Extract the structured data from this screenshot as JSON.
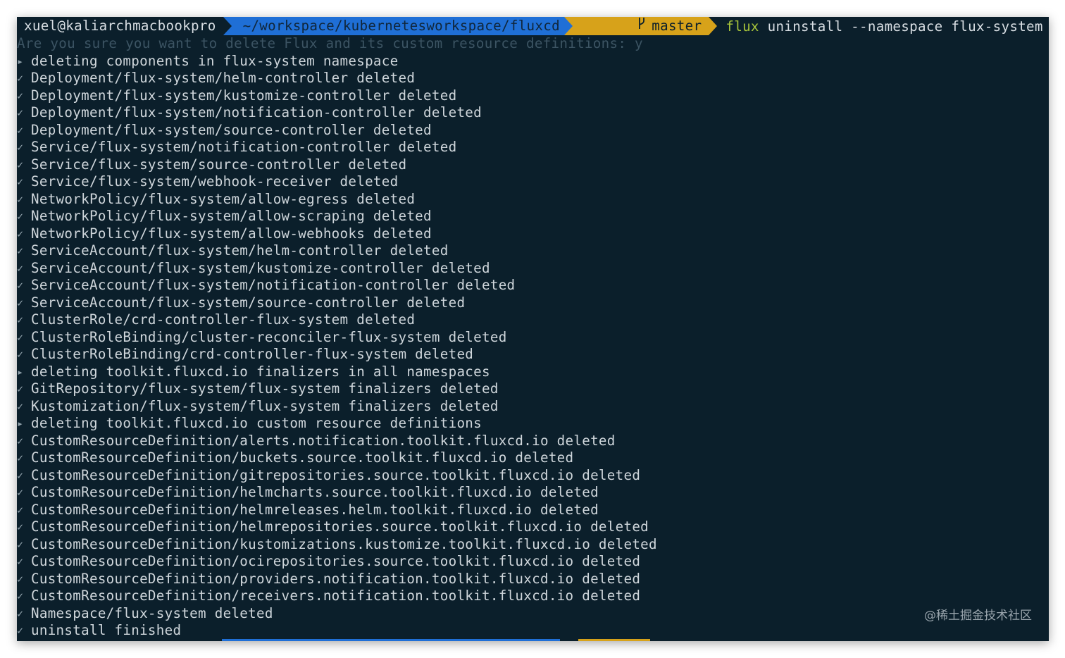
{
  "prompt": {
    "user": "xuel@kaliarchmacbookpro",
    "path": "~/workspace/kubernetesworkspace/fluxcd",
    "branch_icon": "git-branch-icon",
    "branch": "master",
    "command_name": "flux",
    "command_args": " uninstall --namespace flux-system"
  },
  "question": "Are you sure you want to delete Flux and its custom resource definitions: y",
  "output": [
    {
      "mark": "▸",
      "text": "deleting components in flux-system namespace"
    },
    {
      "mark": "✓",
      "text": "Deployment/flux-system/helm-controller deleted"
    },
    {
      "mark": "✓",
      "text": "Deployment/flux-system/kustomize-controller deleted"
    },
    {
      "mark": "✓",
      "text": "Deployment/flux-system/notification-controller deleted"
    },
    {
      "mark": "✓",
      "text": "Deployment/flux-system/source-controller deleted"
    },
    {
      "mark": "✓",
      "text": "Service/flux-system/notification-controller deleted"
    },
    {
      "mark": "✓",
      "text": "Service/flux-system/source-controller deleted"
    },
    {
      "mark": "✓",
      "text": "Service/flux-system/webhook-receiver deleted"
    },
    {
      "mark": "✓",
      "text": "NetworkPolicy/flux-system/allow-egress deleted"
    },
    {
      "mark": "✓",
      "text": "NetworkPolicy/flux-system/allow-scraping deleted"
    },
    {
      "mark": "✓",
      "text": "NetworkPolicy/flux-system/allow-webhooks deleted"
    },
    {
      "mark": "✓",
      "text": "ServiceAccount/flux-system/helm-controller deleted"
    },
    {
      "mark": "✓",
      "text": "ServiceAccount/flux-system/kustomize-controller deleted"
    },
    {
      "mark": "✓",
      "text": "ServiceAccount/flux-system/notification-controller deleted"
    },
    {
      "mark": "✓",
      "text": "ServiceAccount/flux-system/source-controller deleted"
    },
    {
      "mark": "✓",
      "text": "ClusterRole/crd-controller-flux-system deleted"
    },
    {
      "mark": "✓",
      "text": "ClusterRoleBinding/cluster-reconciler-flux-system deleted"
    },
    {
      "mark": "✓",
      "text": "ClusterRoleBinding/crd-controller-flux-system deleted"
    },
    {
      "mark": "▸",
      "text": "deleting toolkit.fluxcd.io finalizers in all namespaces"
    },
    {
      "mark": "✓",
      "text": "GitRepository/flux-system/flux-system finalizers deleted"
    },
    {
      "mark": "✓",
      "text": "Kustomization/flux-system/flux-system finalizers deleted"
    },
    {
      "mark": "▸",
      "text": "deleting toolkit.fluxcd.io custom resource definitions"
    },
    {
      "mark": "✓",
      "text": "CustomResourceDefinition/alerts.notification.toolkit.fluxcd.io deleted"
    },
    {
      "mark": "✓",
      "text": "CustomResourceDefinition/buckets.source.toolkit.fluxcd.io deleted"
    },
    {
      "mark": "✓",
      "text": "CustomResourceDefinition/gitrepositories.source.toolkit.fluxcd.io deleted"
    },
    {
      "mark": "✓",
      "text": "CustomResourceDefinition/helmcharts.source.toolkit.fluxcd.io deleted"
    },
    {
      "mark": "✓",
      "text": "CustomResourceDefinition/helmreleases.helm.toolkit.fluxcd.io deleted"
    },
    {
      "mark": "✓",
      "text": "CustomResourceDefinition/helmrepositories.source.toolkit.fluxcd.io deleted"
    },
    {
      "mark": "✓",
      "text": "CustomResourceDefinition/kustomizations.kustomize.toolkit.fluxcd.io deleted"
    },
    {
      "mark": "✓",
      "text": "CustomResourceDefinition/ocirepositories.source.toolkit.fluxcd.io deleted"
    },
    {
      "mark": "✓",
      "text": "CustomResourceDefinition/providers.notification.toolkit.fluxcd.io deleted"
    },
    {
      "mark": "✓",
      "text": "CustomResourceDefinition/receivers.notification.toolkit.fluxcd.io deleted"
    },
    {
      "mark": "✓",
      "text": "Namespace/flux-system deleted"
    },
    {
      "mark": "✓",
      "text": "uninstall finished"
    }
  ],
  "watermark": "@稀土掘金技术社区",
  "colors": {
    "background": "#0b1f2b",
    "path_segment": "#1f6fd6",
    "git_segment": "#d7a21a",
    "command": "#a7c43a"
  }
}
